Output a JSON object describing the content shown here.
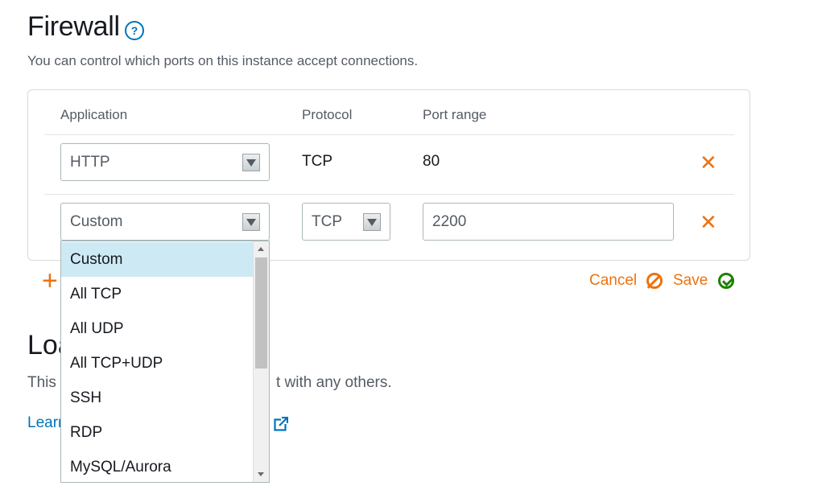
{
  "firewall": {
    "title": "Firewall",
    "help_icon": "?",
    "subtitle": "You can control which ports on this instance accept connections.",
    "columns": [
      "Application",
      "Protocol",
      "Port range"
    ],
    "rows": [
      {
        "application": "HTTP",
        "protocol": "TCP",
        "port_range": "80",
        "remove": "✕"
      },
      {
        "application": "Custom",
        "protocol": "TCP",
        "port_range": "2200",
        "remove": "✕"
      }
    ],
    "add_icon": "+",
    "cancel_label": "Cancel",
    "save_label": "Save"
  },
  "application_dropdown": {
    "options": [
      "Custom",
      "All TCP",
      "All UDP",
      "All TCP+UDP",
      "SSH",
      "RDP",
      "MySQL/Aurora"
    ],
    "selected": "Custom"
  },
  "section2": {
    "title_partial": "Loa",
    "text_left": "This",
    "text_right": "t with any others.",
    "link_partial": "Learn"
  },
  "colors": {
    "accent_orange": "#ec7211",
    "link_blue": "#0073bb",
    "save_green": "#1d8102",
    "selected_bg": "#cdeaf4"
  },
  "icons": {
    "help": "help-circle-icon",
    "remove": "close-x-icon",
    "cancel": "cancel-circle-icon",
    "save": "checkmark-circle-icon",
    "external": "external-link-icon"
  }
}
